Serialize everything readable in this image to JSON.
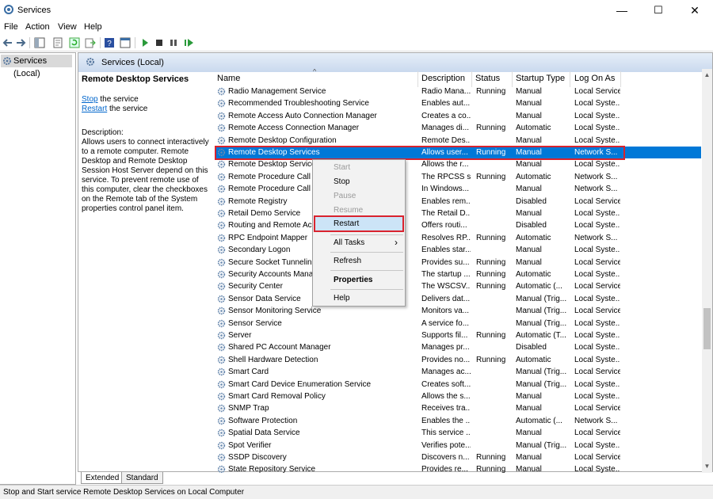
{
  "window": {
    "title": "Services",
    "minimize": "—",
    "maximize": "☐",
    "close": "✕"
  },
  "menu": [
    "File",
    "Action",
    "View",
    "Help"
  ],
  "tree": {
    "item": "Services (Local)"
  },
  "panel": {
    "header": "Services (Local)",
    "service_title": "Remote Desktop Services",
    "stop_link": "Stop",
    "stop_suffix": " the service",
    "restart_link": "Restart",
    "restart_suffix": " the service",
    "desc_label": "Description:",
    "description": "Allows users to connect interactively to a remote computer. Remote Desktop and Remote Desktop Session Host Server depend on this service. To prevent remote use of this computer, clear the checkboxes on the Remote tab of the System properties control panel item."
  },
  "columns": {
    "name": "Name",
    "description": "Description",
    "status": "Status",
    "startup": "Startup Type",
    "logon": "Log On As"
  },
  "rows": [
    {
      "name": "Radio Management Service",
      "desc": "Radio Mana...",
      "status": "Running",
      "startup": "Manual",
      "logon": "Local Service"
    },
    {
      "name": "Recommended Troubleshooting Service",
      "desc": "Enables aut...",
      "status": "",
      "startup": "Manual",
      "logon": "Local Syste..."
    },
    {
      "name": "Remote Access Auto Connection Manager",
      "desc": "Creates a co...",
      "status": "",
      "startup": "Manual",
      "logon": "Local Syste..."
    },
    {
      "name": "Remote Access Connection Manager",
      "desc": "Manages di...",
      "status": "Running",
      "startup": "Automatic",
      "logon": "Local Syste..."
    },
    {
      "name": "Remote Desktop Configuration",
      "desc": "Remote Des...",
      "status": "",
      "startup": "Manual",
      "logon": "Local Syste..."
    },
    {
      "name": "Remote Desktop Services",
      "desc": "Allows user...",
      "status": "Running",
      "startup": "Manual",
      "logon": "Network S..."
    },
    {
      "name": "Remote Desktop Services",
      "desc": "Allows the r...",
      "status": "",
      "startup": "Manual",
      "logon": "Local Syste..."
    },
    {
      "name": "Remote Procedure Call (",
      "desc": "The RPCSS s...",
      "status": "Running",
      "startup": "Automatic",
      "logon": "Network S..."
    },
    {
      "name": "Remote Procedure Call (I",
      "desc": "In Windows...",
      "status": "",
      "startup": "Manual",
      "logon": "Network S..."
    },
    {
      "name": "Remote Registry",
      "desc": "Enables rem...",
      "status": "",
      "startup": "Disabled",
      "logon": "Local Service"
    },
    {
      "name": "Retail Demo Service",
      "desc": "The Retail D...",
      "status": "",
      "startup": "Manual",
      "logon": "Local Syste..."
    },
    {
      "name": "Routing and Remote Acc",
      "desc": "Offers routi...",
      "status": "",
      "startup": "Disabled",
      "logon": "Local Syste..."
    },
    {
      "name": "RPC Endpoint Mapper",
      "desc": "Resolves RP...",
      "status": "Running",
      "startup": "Automatic",
      "logon": "Network S..."
    },
    {
      "name": "Secondary Logon",
      "desc": "Enables star...",
      "status": "",
      "startup": "Manual",
      "logon": "Local Syste..."
    },
    {
      "name": "Secure Socket Tunneling",
      "desc": "Provides su...",
      "status": "Running",
      "startup": "Manual",
      "logon": "Local Service"
    },
    {
      "name": "Security Accounts Manag",
      "desc": "The startup ...",
      "status": "Running",
      "startup": "Automatic",
      "logon": "Local Syste..."
    },
    {
      "name": "Security Center",
      "desc": "The WSCSV...",
      "status": "Running",
      "startup": "Automatic (...",
      "logon": "Local Service"
    },
    {
      "name": "Sensor Data Service",
      "desc": "Delivers dat...",
      "status": "",
      "startup": "Manual (Trig...",
      "logon": "Local Syste..."
    },
    {
      "name": "Sensor Monitoring Service",
      "desc": "Monitors va...",
      "status": "",
      "startup": "Manual (Trig...",
      "logon": "Local Service"
    },
    {
      "name": "Sensor Service",
      "desc": "A service fo...",
      "status": "",
      "startup": "Manual (Trig...",
      "logon": "Local Syste..."
    },
    {
      "name": "Server",
      "desc": "Supports fil...",
      "status": "Running",
      "startup": "Automatic (T...",
      "logon": "Local Syste..."
    },
    {
      "name": "Shared PC Account Manager",
      "desc": "Manages pr...",
      "status": "",
      "startup": "Disabled",
      "logon": "Local Syste..."
    },
    {
      "name": "Shell Hardware Detection",
      "desc": "Provides no...",
      "status": "Running",
      "startup": "Automatic",
      "logon": "Local Syste..."
    },
    {
      "name": "Smart Card",
      "desc": "Manages ac...",
      "status": "",
      "startup": "Manual (Trig...",
      "logon": "Local Service"
    },
    {
      "name": "Smart Card Device Enumeration Service",
      "desc": "Creates soft...",
      "status": "",
      "startup": "Manual (Trig...",
      "logon": "Local Syste..."
    },
    {
      "name": "Smart Card Removal Policy",
      "desc": "Allows the s...",
      "status": "",
      "startup": "Manual",
      "logon": "Local Syste..."
    },
    {
      "name": "SNMP Trap",
      "desc": "Receives tra...",
      "status": "",
      "startup": "Manual",
      "logon": "Local Service"
    },
    {
      "name": "Software Protection",
      "desc": "Enables the ...",
      "status": "",
      "startup": "Automatic (...",
      "logon": "Network S..."
    },
    {
      "name": "Spatial Data Service",
      "desc": "This service ...",
      "status": "",
      "startup": "Manual",
      "logon": "Local Service"
    },
    {
      "name": "Spot Verifier",
      "desc": "Verifies pote...",
      "status": "",
      "startup": "Manual (Trig...",
      "logon": "Local Syste..."
    },
    {
      "name": "SSDP Discovery",
      "desc": "Discovers n...",
      "status": "Running",
      "startup": "Manual",
      "logon": "Local Service"
    },
    {
      "name": "State Repository Service",
      "desc": "Provides re...",
      "status": "Running",
      "startup": "Manual",
      "logon": "Local Syste..."
    }
  ],
  "context_menu": {
    "start": "Start",
    "stop": "Stop",
    "pause": "Pause",
    "resume": "Resume",
    "restart": "Restart",
    "all_tasks": "All Tasks",
    "all_tasks_arrow": "›",
    "refresh": "Refresh",
    "properties": "Properties",
    "help": "Help"
  },
  "tabs": {
    "extended": "Extended",
    "standard": "Standard"
  },
  "status_bar": "Stop and Start service Remote Desktop Services on Local Computer",
  "colors": {
    "selection": "#0078d7",
    "highlight_box": "#d9232e",
    "link": "#0066cc"
  },
  "icons": {
    "back": "back-arrow-icon",
    "forward": "forward-arrow-icon",
    "service": "gear-icon"
  }
}
